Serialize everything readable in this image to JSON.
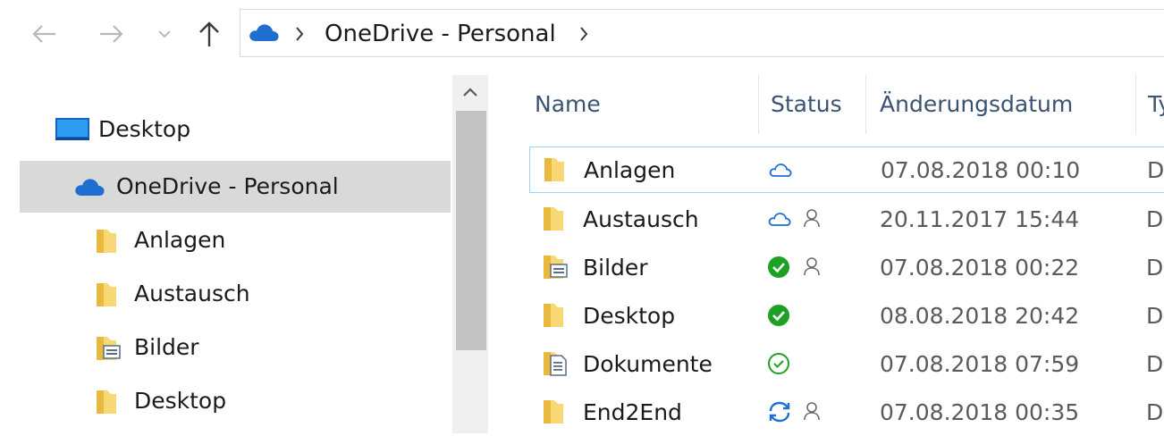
{
  "addressbar": {
    "crumbs": [
      "OneDrive - Personal"
    ]
  },
  "tree": {
    "items": [
      {
        "label": "Desktop",
        "icon": "desktop-icon"
      },
      {
        "label": "OneDrive - Personal",
        "icon": "onedrive-cloud-icon",
        "selected": true
      },
      {
        "label": "Anlagen",
        "icon": "folder-icon"
      },
      {
        "label": "Austausch",
        "icon": "folder-icon"
      },
      {
        "label": "Bilder",
        "icon": "pictures-folder-icon"
      },
      {
        "label": "Desktop",
        "icon": "folder-icon"
      }
    ]
  },
  "columns": {
    "name": "Name",
    "status": "Status",
    "date": "Änderungsdatum",
    "type": "Ty"
  },
  "files": [
    {
      "name": "Anlagen",
      "status": "online-only",
      "shared": false,
      "date": "07.08.2018 00:10",
      "type": "D"
    },
    {
      "name": "Austausch",
      "status": "online-only",
      "shared": true,
      "date": "20.11.2017 15:44",
      "type": "D"
    },
    {
      "name": "Bilder",
      "status": "always-available",
      "shared": true,
      "date": "07.08.2018 00:22",
      "type": "D"
    },
    {
      "name": "Desktop",
      "status": "always-available",
      "shared": false,
      "date": "08.08.2018 20:42",
      "type": "D"
    },
    {
      "name": "Dokumente",
      "status": "locally-available",
      "shared": false,
      "date": "07.08.2018 07:59",
      "type": "D"
    },
    {
      "name": "End2End",
      "status": "syncing",
      "shared": true,
      "date": "07.08.2018 00:35",
      "type": "D"
    }
  ],
  "colors": {
    "accent": "#1e6fd0",
    "selection": "#d9d9d9",
    "focus_border": "#99d1ff",
    "status_green": "#1ea024",
    "folder_yellow": "#f8d775"
  }
}
